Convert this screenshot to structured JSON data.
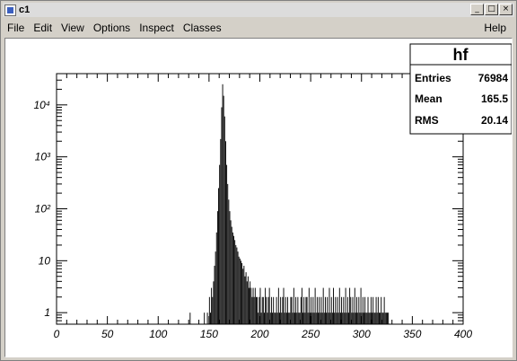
{
  "window": {
    "title": "c1",
    "controls": {
      "minimize": "_",
      "maximize": "□",
      "close": "×"
    }
  },
  "menu": {
    "items": [
      "File",
      "Edit",
      "View",
      "Options",
      "Inspect",
      "Classes"
    ],
    "help": "Help"
  },
  "stats": {
    "title": "hf",
    "rows": [
      {
        "label": "Entries",
        "value": "76984"
      },
      {
        "label": "Mean",
        "value": "165.5"
      },
      {
        "label": "RMS",
        "value": "20.14"
      }
    ]
  },
  "chart_data": {
    "type": "bar",
    "title": "hf",
    "xlabel": "",
    "ylabel": "",
    "xlim": [
      0,
      400
    ],
    "ylim": [
      0.6,
      40000
    ],
    "yscale": "log",
    "x_ticks": [
      "0",
      "50",
      "100",
      "150",
      "200",
      "250",
      "300",
      "350",
      "400"
    ],
    "y_ticks": [
      {
        "value": 1,
        "label": "1"
      },
      {
        "value": 10,
        "label": "10"
      },
      {
        "value": 100,
        "label": "10²"
      },
      {
        "value": 1000,
        "label": "10³"
      },
      {
        "value": 10000,
        "label": "10⁴"
      }
    ],
    "bin_width": 1,
    "bins": [
      {
        "x": 131,
        "y": 1
      },
      {
        "x": 145,
        "y": 1
      },
      {
        "x": 148,
        "y": 1
      },
      {
        "x": 150,
        "y": 2
      },
      {
        "x": 151,
        "y": 1
      },
      {
        "x": 152,
        "y": 3
      },
      {
        "x": 153,
        "y": 2
      },
      {
        "x": 154,
        "y": 4
      },
      {
        "x": 155,
        "y": 8
      },
      {
        "x": 156,
        "y": 15
      },
      {
        "x": 157,
        "y": 35
      },
      {
        "x": 158,
        "y": 90
      },
      {
        "x": 159,
        "y": 250
      },
      {
        "x": 160,
        "y": 700
      },
      {
        "x": 161,
        "y": 2200
      },
      {
        "x": 162,
        "y": 9000
      },
      {
        "x": 163,
        "y": 25000
      },
      {
        "x": 164,
        "y": 15000
      },
      {
        "x": 165,
        "y": 6000
      },
      {
        "x": 166,
        "y": 2000
      },
      {
        "x": 167,
        "y": 700
      },
      {
        "x": 168,
        "y": 300
      },
      {
        "x": 169,
        "y": 150
      },
      {
        "x": 170,
        "y": 90
      },
      {
        "x": 171,
        "y": 60
      },
      {
        "x": 172,
        "y": 45
      },
      {
        "x": 173,
        "y": 35
      },
      {
        "x": 174,
        "y": 30
      },
      {
        "x": 175,
        "y": 25
      },
      {
        "x": 176,
        "y": 20
      },
      {
        "x": 177,
        "y": 18
      },
      {
        "x": 178,
        "y": 15
      },
      {
        "x": 179,
        "y": 12
      },
      {
        "x": 180,
        "y": 11
      },
      {
        "x": 181,
        "y": 10
      },
      {
        "x": 182,
        "y": 9
      },
      {
        "x": 183,
        "y": 7
      },
      {
        "x": 184,
        "y": 8
      },
      {
        "x": 185,
        "y": 5
      },
      {
        "x": 186,
        "y": 6
      },
      {
        "x": 187,
        "y": 4
      },
      {
        "x": 188,
        "y": 5
      },
      {
        "x": 189,
        "y": 3
      },
      {
        "x": 190,
        "y": 4
      },
      {
        "x": 191,
        "y": 3
      },
      {
        "x": 192,
        "y": 2
      },
      {
        "x": 193,
        "y": 3
      },
      {
        "x": 194,
        "y": 2
      },
      {
        "x": 195,
        "y": 3
      },
      {
        "x": 196,
        "y": 2
      },
      {
        "x": 197,
        "y": 2
      },
      {
        "x": 198,
        "y": 1
      },
      {
        "x": 199,
        "y": 2
      },
      {
        "x": 200,
        "y": 3
      },
      {
        "x": 201,
        "y": 1
      },
      {
        "x": 202,
        "y": 2
      },
      {
        "x": 203,
        "y": 2
      },
      {
        "x": 204,
        "y": 1
      },
      {
        "x": 205,
        "y": 3
      },
      {
        "x": 206,
        "y": 2
      },
      {
        "x": 207,
        "y": 1
      },
      {
        "x": 208,
        "y": 2
      },
      {
        "x": 209,
        "y": 3
      },
      {
        "x": 210,
        "y": 1
      },
      {
        "x": 211,
        "y": 2
      },
      {
        "x": 212,
        "y": 1
      },
      {
        "x": 213,
        "y": 2
      },
      {
        "x": 214,
        "y": 1
      },
      {
        "x": 215,
        "y": 1
      },
      {
        "x": 216,
        "y": 2
      },
      {
        "x": 217,
        "y": 1
      },
      {
        "x": 218,
        "y": 3
      },
      {
        "x": 219,
        "y": 1
      },
      {
        "x": 220,
        "y": 2
      },
      {
        "x": 221,
        "y": 1
      },
      {
        "x": 222,
        "y": 2
      },
      {
        "x": 223,
        "y": 3
      },
      {
        "x": 224,
        "y": 1
      },
      {
        "x": 225,
        "y": 2
      },
      {
        "x": 226,
        "y": 1
      },
      {
        "x": 227,
        "y": 2
      },
      {
        "x": 228,
        "y": 1
      },
      {
        "x": 229,
        "y": 1
      },
      {
        "x": 230,
        "y": 2
      },
      {
        "x": 231,
        "y": 2
      },
      {
        "x": 232,
        "y": 1
      },
      {
        "x": 233,
        "y": 3
      },
      {
        "x": 234,
        "y": 1
      },
      {
        "x": 235,
        "y": 2
      },
      {
        "x": 236,
        "y": 1
      },
      {
        "x": 237,
        "y": 2
      },
      {
        "x": 238,
        "y": 1
      },
      {
        "x": 239,
        "y": 1
      },
      {
        "x": 240,
        "y": 2
      },
      {
        "x": 241,
        "y": 3
      },
      {
        "x": 242,
        "y": 1
      },
      {
        "x": 243,
        "y": 2
      },
      {
        "x": 244,
        "y": 1
      },
      {
        "x": 245,
        "y": 2
      },
      {
        "x": 246,
        "y": 2
      },
      {
        "x": 247,
        "y": 1
      },
      {
        "x": 248,
        "y": 3
      },
      {
        "x": 249,
        "y": 1
      },
      {
        "x": 250,
        "y": 2
      },
      {
        "x": 251,
        "y": 1
      },
      {
        "x": 252,
        "y": 2
      },
      {
        "x": 253,
        "y": 1
      },
      {
        "x": 254,
        "y": 3
      },
      {
        "x": 255,
        "y": 1
      },
      {
        "x": 256,
        "y": 2
      },
      {
        "x": 257,
        "y": 1
      },
      {
        "x": 258,
        "y": 2
      },
      {
        "x": 259,
        "y": 1
      },
      {
        "x": 260,
        "y": 2
      },
      {
        "x": 261,
        "y": 1
      },
      {
        "x": 262,
        "y": 3
      },
      {
        "x": 263,
        "y": 1
      },
      {
        "x": 264,
        "y": 2
      },
      {
        "x": 265,
        "y": 1
      },
      {
        "x": 266,
        "y": 2
      },
      {
        "x": 267,
        "y": 1
      },
      {
        "x": 268,
        "y": 3
      },
      {
        "x": 269,
        "y": 1
      },
      {
        "x": 270,
        "y": 2
      },
      {
        "x": 271,
        "y": 1
      },
      {
        "x": 272,
        "y": 3
      },
      {
        "x": 273,
        "y": 1
      },
      {
        "x": 274,
        "y": 2
      },
      {
        "x": 275,
        "y": 1
      },
      {
        "x": 276,
        "y": 2
      },
      {
        "x": 277,
        "y": 1
      },
      {
        "x": 278,
        "y": 3
      },
      {
        "x": 279,
        "y": 1
      },
      {
        "x": 280,
        "y": 2
      },
      {
        "x": 281,
        "y": 1
      },
      {
        "x": 282,
        "y": 2
      },
      {
        "x": 283,
        "y": 1
      },
      {
        "x": 284,
        "y": 3
      },
      {
        "x": 285,
        "y": 1
      },
      {
        "x": 286,
        "y": 2
      },
      {
        "x": 287,
        "y": 1
      },
      {
        "x": 288,
        "y": 3
      },
      {
        "x": 289,
        "y": 2
      },
      {
        "x": 290,
        "y": 1
      },
      {
        "x": 291,
        "y": 2
      },
      {
        "x": 292,
        "y": 1
      },
      {
        "x": 293,
        "y": 3
      },
      {
        "x": 294,
        "y": 1
      },
      {
        "x": 295,
        "y": 2
      },
      {
        "x": 296,
        "y": 1
      },
      {
        "x": 297,
        "y": 2
      },
      {
        "x": 298,
        "y": 1
      },
      {
        "x": 299,
        "y": 3
      },
      {
        "x": 300,
        "y": 1
      },
      {
        "x": 301,
        "y": 2
      },
      {
        "x": 302,
        "y": 1
      },
      {
        "x": 303,
        "y": 2
      },
      {
        "x": 304,
        "y": 1
      },
      {
        "x": 305,
        "y": 1
      },
      {
        "x": 306,
        "y": 2
      },
      {
        "x": 307,
        "y": 1
      },
      {
        "x": 308,
        "y": 1
      },
      {
        "x": 309,
        "y": 2
      },
      {
        "x": 310,
        "y": 1
      },
      {
        "x": 311,
        "y": 2
      },
      {
        "x": 312,
        "y": 1
      },
      {
        "x": 313,
        "y": 1
      },
      {
        "x": 314,
        "y": 2
      },
      {
        "x": 315,
        "y": 1
      },
      {
        "x": 316,
        "y": 2
      },
      {
        "x": 317,
        "y": 1
      },
      {
        "x": 318,
        "y": 1
      },
      {
        "x": 319,
        "y": 2
      },
      {
        "x": 320,
        "y": 1
      },
      {
        "x": 321,
        "y": 1
      },
      {
        "x": 322,
        "y": 2
      },
      {
        "x": 323,
        "y": 1
      },
      {
        "x": 324,
        "y": 1
      },
      {
        "x": 325,
        "y": 1
      },
      {
        "x": 326,
        "y": 1
      }
    ]
  }
}
